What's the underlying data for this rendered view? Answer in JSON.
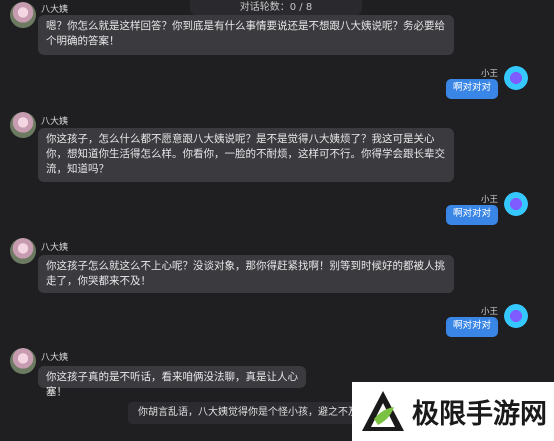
{
  "header": {
    "rounds_label": "对话轮数：0 / 8"
  },
  "messages": [
    {
      "speaker": "八大姨",
      "side": "left",
      "text": "嗯？你怎么就是这样回答？你到底是有什么事情要说还是不想跟八大姨说呢？务必要给个明确的答案！"
    },
    {
      "speaker": "小王",
      "side": "right",
      "text": "啊对对对"
    },
    {
      "speaker": "八大姨",
      "side": "left",
      "text": "你这孩子，怎么什么都不愿意跟八大姨说呢？是不是觉得八大姨烦了？我这可是关心你，想知道你生活得怎么样。你看你，一脸的不耐烦，这样可不行。你得学会跟长辈交流，知道吗？"
    },
    {
      "speaker": "小王",
      "side": "right",
      "text": "啊对对对"
    },
    {
      "speaker": "八大姨",
      "side": "left",
      "text": "你这孩子怎么就这么不上心呢？没谈对象，那你得赶紧找啊！别等到时候好的都被人挑走了，你哭都来不及！"
    },
    {
      "speaker": "小王",
      "side": "right",
      "text": "啊对对对"
    },
    {
      "speaker": "八大姨",
      "side": "left",
      "text": "你这孩子真的是不听话，看来咱俩没法聊，真是让人心塞！"
    }
  ],
  "bottom_status": "你胡言乱语，八大姨觉得你是个怪小孩，避之不及",
  "watermark": {
    "text": "极限手游网"
  },
  "colors": {
    "background": "#1f1f22",
    "bubble_left": "#3a3a3f",
    "bubble_right": "#3a86e6"
  }
}
